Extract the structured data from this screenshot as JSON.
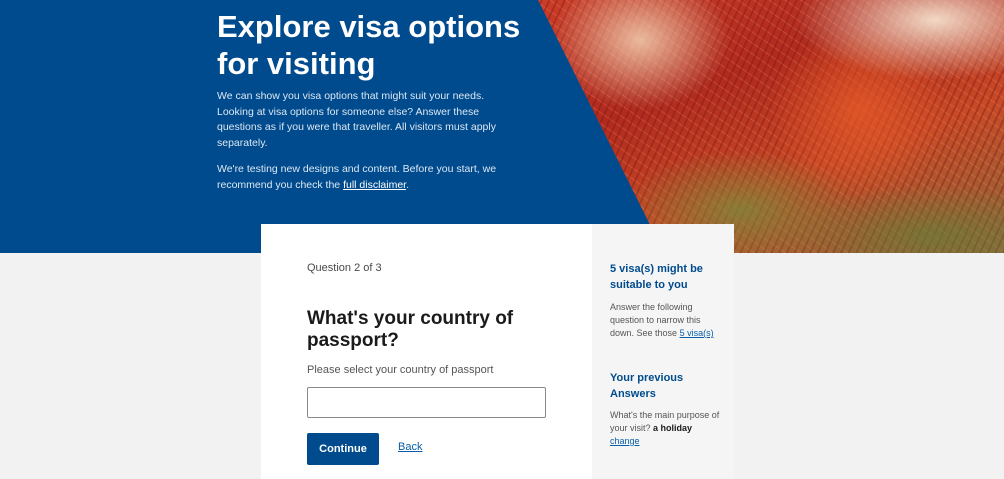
{
  "hero": {
    "title": "Explore visa options for visiting",
    "intro": "We can show you visa options that might suit your needs. Looking at visa options for someone else? Answer these questions as if you were that traveller. All visitors must apply separately.",
    "testing_text": "We're testing new designs and content. Before you start, we recommend you check the ",
    "disclaimer_link": "full disclaimer",
    "disclaimer_suffix": "."
  },
  "question": {
    "counter": "Question 2 of 3",
    "title": "What's your country of passport?",
    "label": "Please select your country of passport",
    "input_value": "",
    "continue_label": "Continue",
    "back_label": "Back"
  },
  "sidebar": {
    "suitable_heading": "5 visa(s) might be suitable to you",
    "suitable_text": "Answer the following question to narrow this down. See those ",
    "suitable_link": "5 visa(s)",
    "previous_heading": "Your previous Answers",
    "previous_question": "What's the main purpose of your visit? ",
    "previous_answer": "a holiday",
    "change_link": "change"
  },
  "colors": {
    "brand_blue": "#004b8d",
    "link_blue": "#0a5ea8",
    "page_bg": "#f2f2f2"
  }
}
